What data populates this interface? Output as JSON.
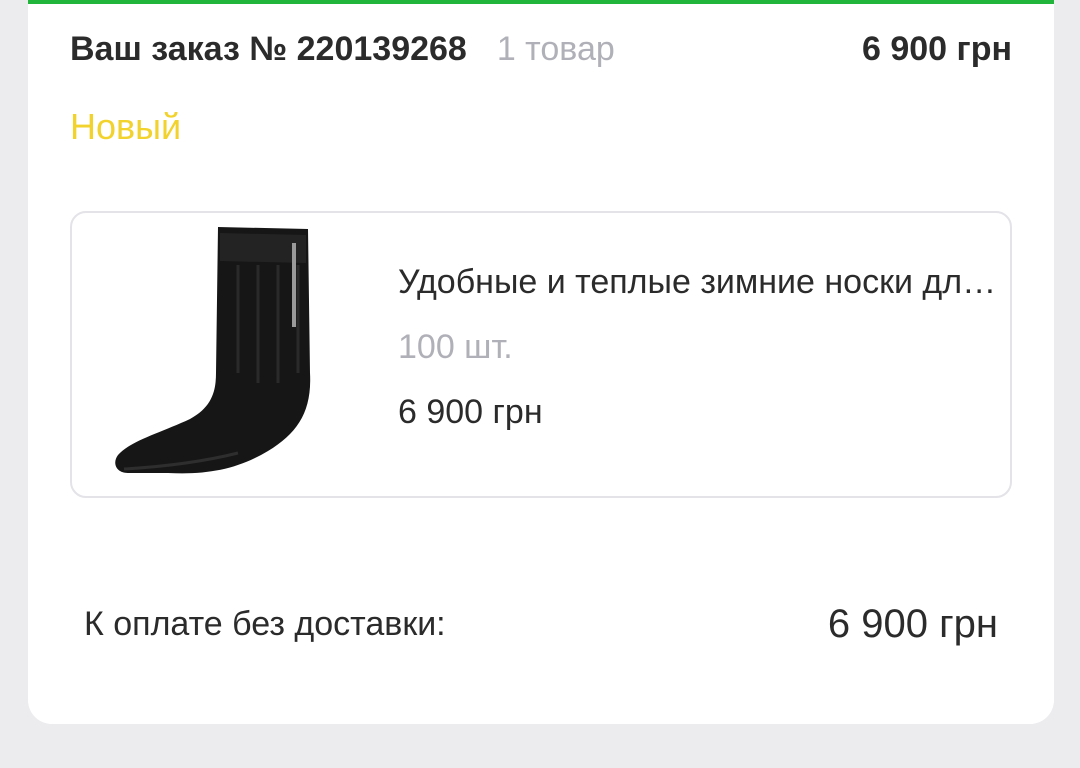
{
  "order": {
    "title": "Ваш заказ № 220139268",
    "items_count": "1 товар",
    "total": "6 900 грн",
    "status": "Новый"
  },
  "product": {
    "name": "Удобные и теплые зимние носки для мужчин",
    "quantity": "100 шт.",
    "price": "6 900 грн",
    "image": "black-sock-image"
  },
  "payment": {
    "label": "К оплате без доставки:",
    "total": "6 900 грн"
  },
  "colors": {
    "accent_green": "#22b53b",
    "status_yellow": "#f2d22c",
    "muted_gray": "#b0b0b8",
    "background": "#ececef"
  }
}
